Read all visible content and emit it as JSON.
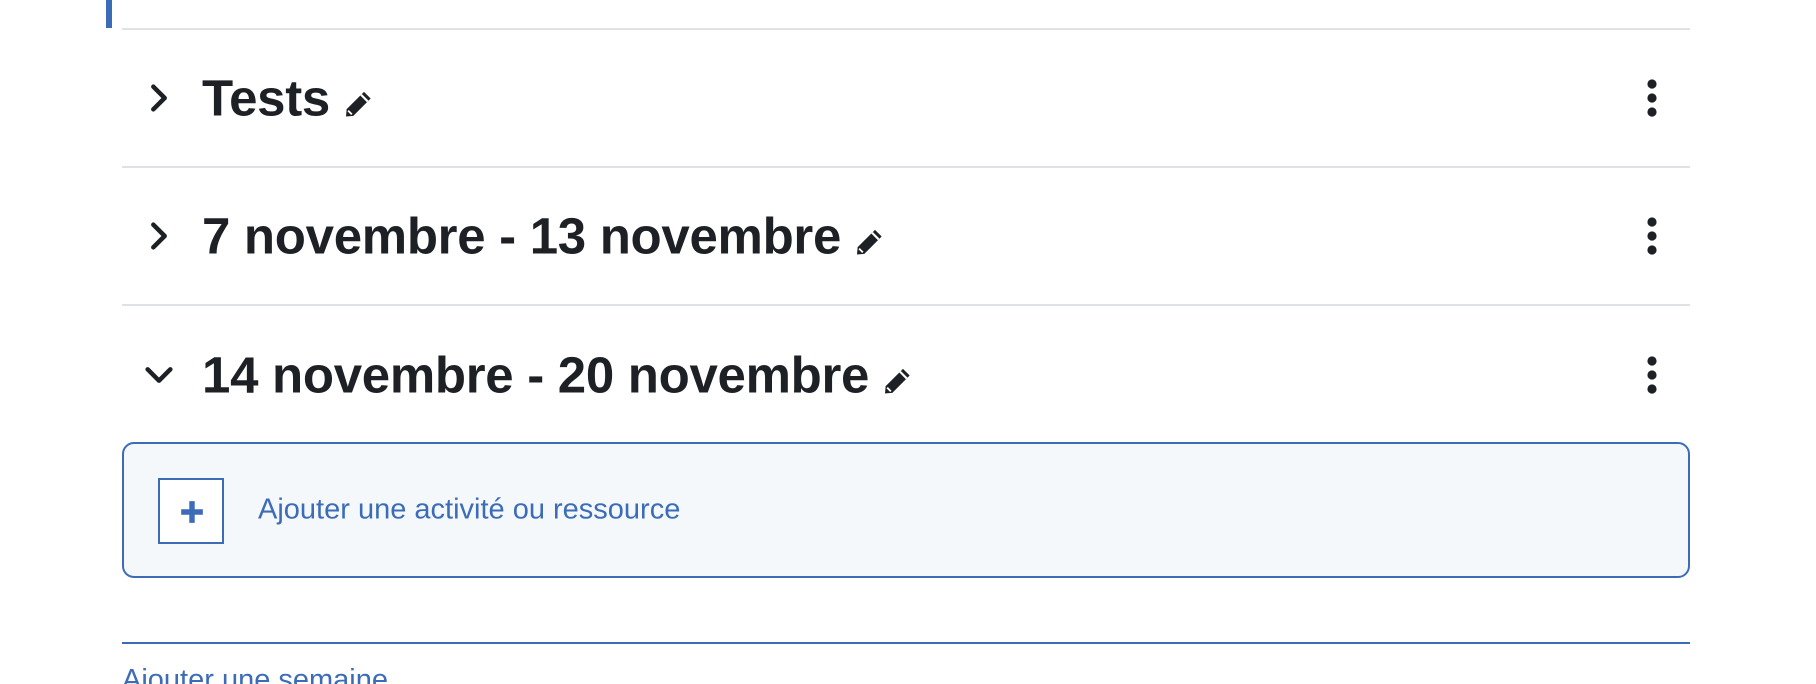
{
  "sections": [
    {
      "title": "Tests",
      "expanded": false,
      "toggle_icon": "chevron-right-icon",
      "edit_icon": "pencil-icon",
      "menu_icon": "vertical-ellipsis-icon"
    },
    {
      "title": "7 novembre - 13 novembre",
      "expanded": false,
      "toggle_icon": "chevron-right-icon",
      "edit_icon": "pencil-icon",
      "menu_icon": "vertical-ellipsis-icon"
    },
    {
      "title": "14 novembre - 20 novembre",
      "expanded": true,
      "toggle_icon": "chevron-down-icon",
      "edit_icon": "pencil-icon",
      "menu_icon": "vertical-ellipsis-icon"
    }
  ],
  "add_activity": {
    "label": "Ajouter une activité ou ressource",
    "icon": "plus-icon"
  },
  "add_week_label": "Ajouter une semaine",
  "colors": {
    "accent": "#3c6cb7",
    "text": "#1d2125",
    "divider": "#dee2e6",
    "add_box_bg": "#f5f8fb"
  }
}
